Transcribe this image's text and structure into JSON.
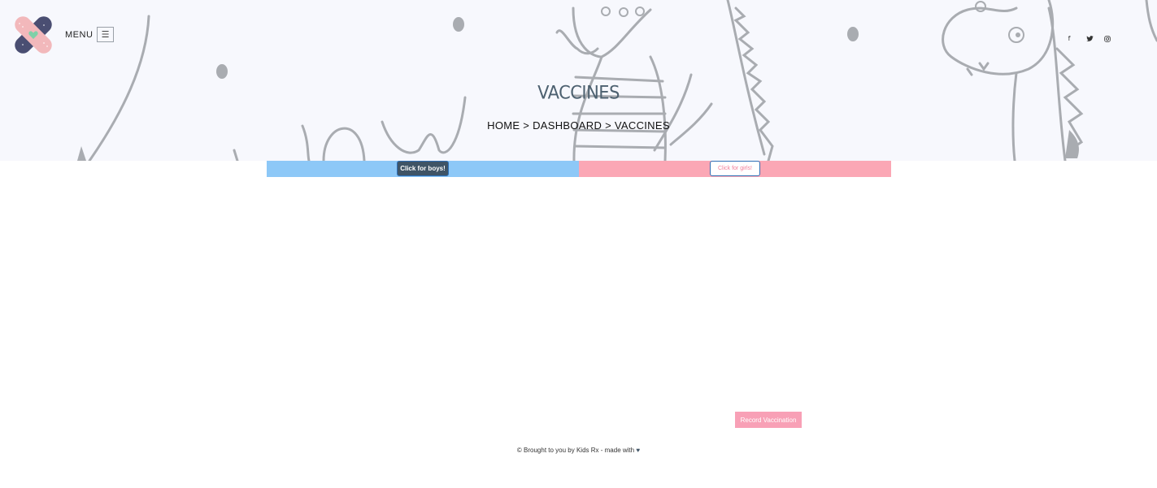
{
  "header": {
    "menu_label": "MENU",
    "menu_icon": "☰",
    "social": [
      {
        "name": "facebook",
        "glyph": "f"
      },
      {
        "name": "twitter",
        "glyph": "🐦"
      },
      {
        "name": "instagram",
        "glyph": "◎"
      }
    ]
  },
  "hero": {
    "title": "VACCINES",
    "breadcrumb": {
      "home": "HOME",
      "sep1": ">",
      "dashboard": "DASHBOARD",
      "sep2": ">",
      "current": "VACCINES"
    }
  },
  "tabs": {
    "boys_label": "Click for boys!",
    "girls_label": "Click for girls!"
  },
  "actions": {
    "record_label": "Record Vaccination"
  },
  "footer": {
    "text": "© Brought to you by Kids Rx - made with",
    "heart": "♥"
  },
  "colors": {
    "boys": "#8dc8f7",
    "girls": "#fba7b5",
    "accent_dark": "#3f5466",
    "record": "#f8a0b6"
  }
}
